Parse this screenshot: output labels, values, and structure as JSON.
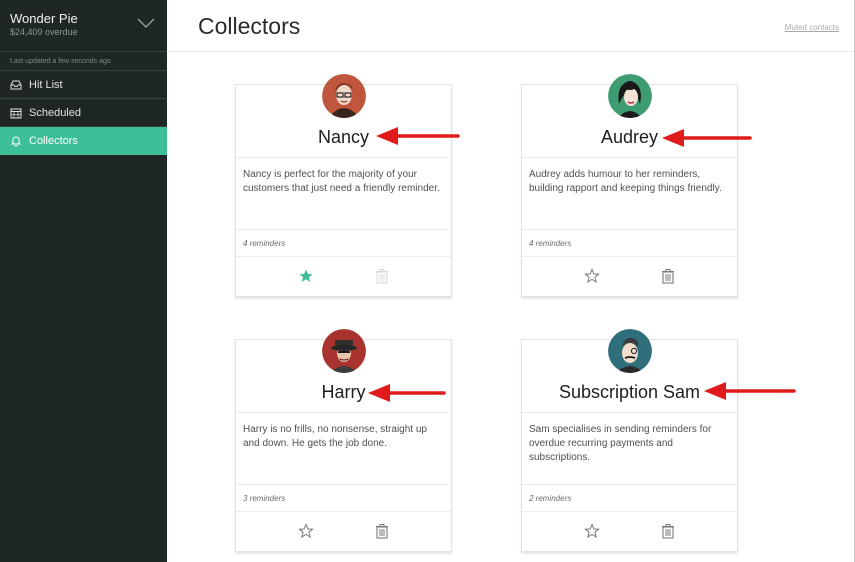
{
  "account": {
    "name": "Wonder Pie",
    "overdue": "$24,409 overdue"
  },
  "sidebar": {
    "updated": "Last updated a few seconds ago",
    "items": [
      {
        "label": "Hit List",
        "icon": "inbox-icon"
      },
      {
        "label": "Scheduled",
        "icon": "calendar-icon"
      },
      {
        "label": "Collectors",
        "icon": "bell-icon"
      }
    ]
  },
  "header": {
    "title": "Collectors",
    "muted_link": "Muted contacts"
  },
  "colors": {
    "accent": "#3cbf97",
    "sidebar_bg": "#1f2626",
    "arrow_red": "#e01b1b"
  },
  "collectors": [
    {
      "name": "Nancy",
      "description": "Nancy is perfect for the majority of your customers that just need a friendly reminder.",
      "reminders": "4 reminders",
      "starred": true
    },
    {
      "name": "Audrey",
      "description": "Audrey adds humour to her reminders, building rapport and keeping things friendly.",
      "reminders": "4 reminders",
      "starred": false
    },
    {
      "name": "Harry",
      "description": "Harry is no frills, no nonsense, straight up and down. He gets the job done.",
      "reminders": "3 reminders",
      "starred": false
    },
    {
      "name": "Subscription Sam",
      "description": "Sam specialises in sending reminders for overdue recurring payments and subscriptions.",
      "reminders": "2 reminders",
      "starred": false
    }
  ]
}
